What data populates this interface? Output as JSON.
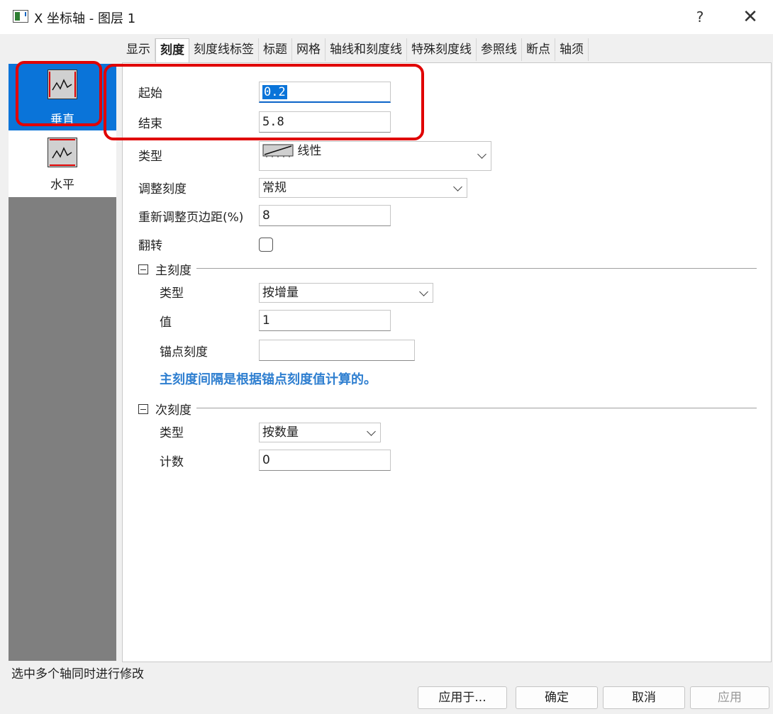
{
  "window": {
    "title": "X 坐标轴 - 图层 1",
    "help": "?",
    "close": "✕"
  },
  "tabs": [
    "显示",
    "刻度",
    "刻度线标签",
    "标题",
    "网格",
    "轴线和刻度线",
    "特殊刻度线",
    "参照线",
    "断点",
    "轴须"
  ],
  "active_tab": "刻度",
  "sidebar": {
    "items": [
      {
        "label": "垂直",
        "icon": "vertical-axis-icon",
        "selected": true
      },
      {
        "label": "水平",
        "icon": "horizontal-axis-icon",
        "selected": false
      }
    ]
  },
  "form": {
    "start_label": "起始",
    "start_value": "0.2",
    "end_label": "结束",
    "end_value": "5.8",
    "type_label": "类型",
    "type_value": "线性",
    "rescale_label": "调整刻度",
    "rescale_value": "常规",
    "margin_label": "重新调整页边距(%)",
    "margin_value": "8",
    "flip_label": "翻转",
    "flip_checked": false
  },
  "major": {
    "header": "主刻度",
    "type_label": "类型",
    "type_value": "按增量",
    "value_label": "值",
    "value": "1",
    "anchor_label": "锚点刻度",
    "anchor_value": "",
    "hint": "主刻度间隔是根据锚点刻度值计算的。"
  },
  "minor": {
    "header": "次刻度",
    "type_label": "类型",
    "type_value": "按数量",
    "count_label": "计数",
    "count_value": "0"
  },
  "status": "选中多个轴同时进行修改",
  "buttons": {
    "apply_to": "应用于...",
    "ok": "确定",
    "cancel": "取消",
    "apply": "应用"
  },
  "colors": {
    "accent": "#0a74d9",
    "highlight_ring": "#e00000",
    "hint_text": "#2f7fd0"
  }
}
